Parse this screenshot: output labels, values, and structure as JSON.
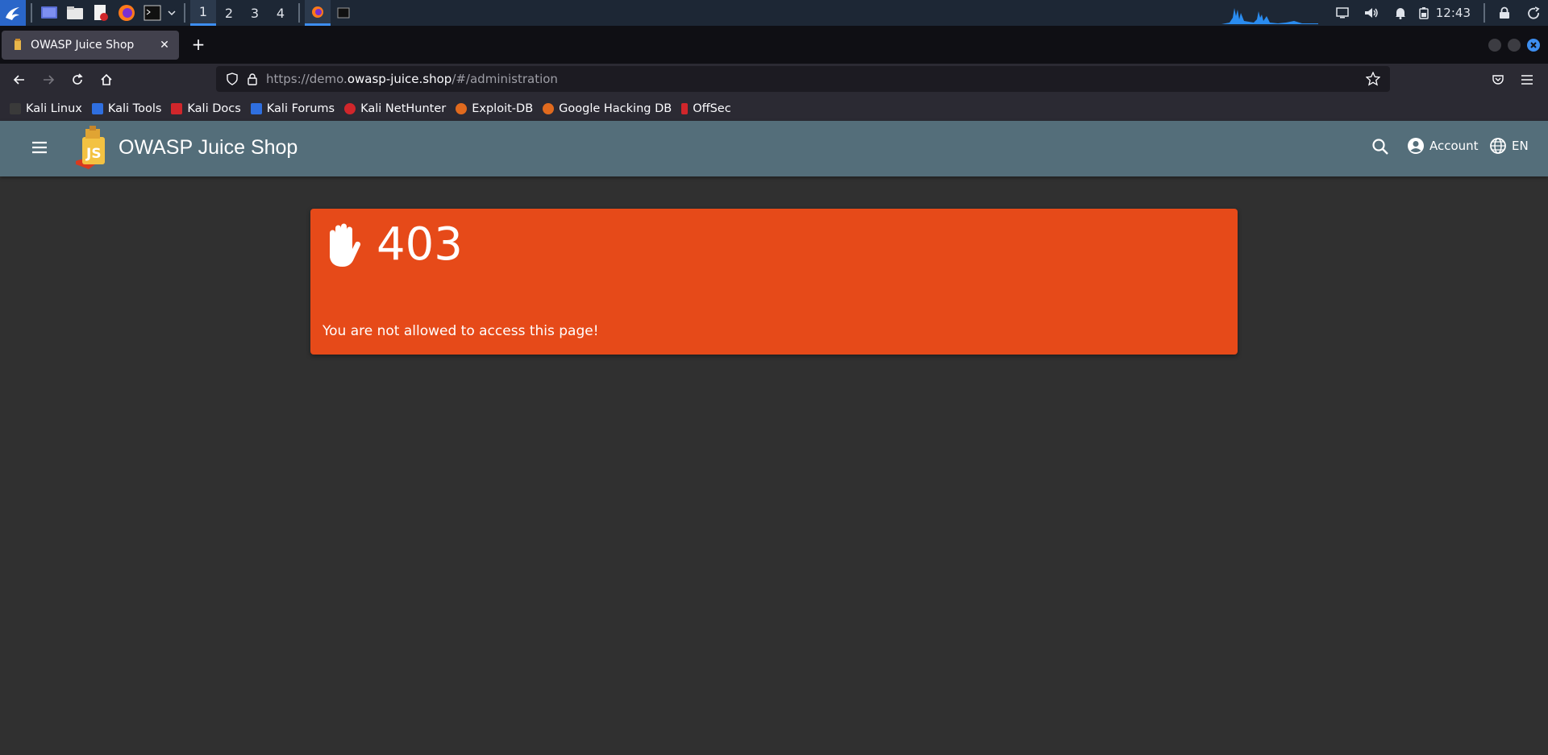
{
  "taskbar": {
    "workspaces": [
      "1",
      "2",
      "3",
      "4"
    ],
    "active_workspace": "1",
    "clock": "12:43"
  },
  "browser": {
    "tab": {
      "title": "OWASP Juice Shop"
    },
    "url": {
      "prefix": "https://demo.",
      "domain": "owasp-juice.shop",
      "path": "/#/administration"
    },
    "bookmarks": [
      {
        "label": "Kali Linux",
        "color": "#3a3a3a"
      },
      {
        "label": "Kali Tools",
        "color": "#2f6fe0"
      },
      {
        "label": "Kali Docs",
        "color": "#d0262b"
      },
      {
        "label": "Kali Forums",
        "color": "#2f6fe0"
      },
      {
        "label": "Kali NetHunter",
        "color": "#d0262b"
      },
      {
        "label": "Exploit-DB",
        "color": "#e06a1e"
      },
      {
        "label": "Google Hacking DB",
        "color": "#e06a1e"
      },
      {
        "label": "OffSec",
        "color": "#d0262b"
      }
    ]
  },
  "app": {
    "title": "OWASP Juice Shop",
    "account_label": "Account",
    "language_label": "EN",
    "toolbar_color": "#546e7a"
  },
  "error": {
    "code": "403",
    "message": "You are not allowed to access this page!",
    "color": "#e64a19"
  }
}
